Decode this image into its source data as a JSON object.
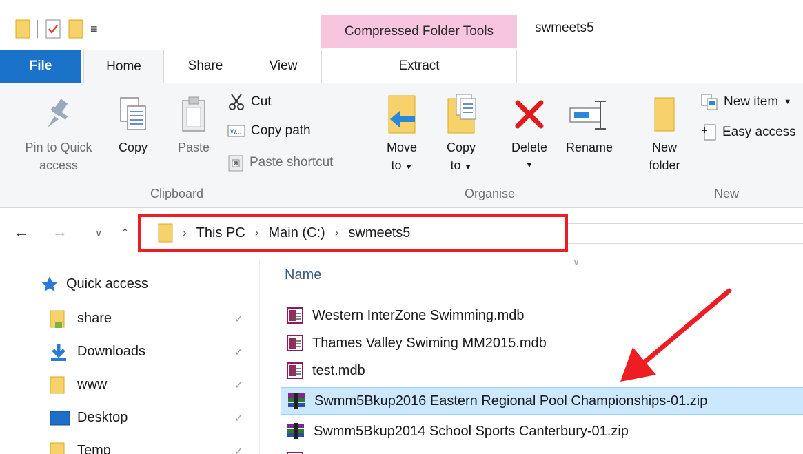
{
  "title_bar": {
    "contextual_tab": "Compressed Folder Tools",
    "window_title": "swmeets5"
  },
  "tabs": [
    {
      "label": "File"
    },
    {
      "label": "Home"
    },
    {
      "label": "Share"
    },
    {
      "label": "View"
    },
    {
      "label": "Extract"
    }
  ],
  "ribbon": {
    "clipboard": {
      "pin_label_1": "Pin to Quick",
      "pin_label_2": "access",
      "copy": "Copy",
      "paste": "Paste",
      "cut": "Cut",
      "copy_path": "Copy path",
      "paste_shortcut": "Paste shortcut",
      "group": "Clipboard"
    },
    "organise": {
      "move_1": "Move",
      "move_2": "to",
      "copy_1": "Copy",
      "copy_2": "to",
      "delete": "Delete",
      "rename": "Rename",
      "group": "Organise"
    },
    "new": {
      "folder_1": "New",
      "folder_2": "folder",
      "new_item": "New item",
      "easy_access": "Easy access",
      "group": "New"
    }
  },
  "address": {
    "crumbs": [
      "This PC",
      "Main (C:)",
      "swmeets5"
    ]
  },
  "nav_pane": {
    "quick_access": "Quick access",
    "items": [
      {
        "label": "share",
        "icon": "folder-icon"
      },
      {
        "label": "Downloads",
        "icon": "download-icon"
      },
      {
        "label": "www",
        "icon": "folder-icon"
      },
      {
        "label": "Desktop",
        "icon": "desktop-icon"
      },
      {
        "label": "Temp",
        "icon": "folder-icon"
      }
    ]
  },
  "files": {
    "column_name": "Name",
    "rows": [
      {
        "name": "Western InterZone Swimming.mdb",
        "icon": "mdb-file-icon",
        "selected": false
      },
      {
        "name": "Thames Valley Swiming MM2015.mdb",
        "icon": "mdb-file-icon",
        "selected": false
      },
      {
        "name": "test.mdb",
        "icon": "mdb-file-icon",
        "selected": false
      },
      {
        "name": "Swmm5Bkup2016 Eastern Regional Pool Championships-01.zip",
        "icon": "zip-archive-icon",
        "selected": true
      },
      {
        "name": "Swmm5Bkup2014 School Sports Canterbury-01.zip",
        "icon": "zip-archive-icon",
        "selected": false
      }
    ]
  },
  "colors": {
    "file_tab": "#1a73c8",
    "contextual_tab": "#f7c5dd",
    "highlight_box": "#ee1d23",
    "selection": "#cce8ff",
    "annotation_arrow": "#ee1d23"
  }
}
